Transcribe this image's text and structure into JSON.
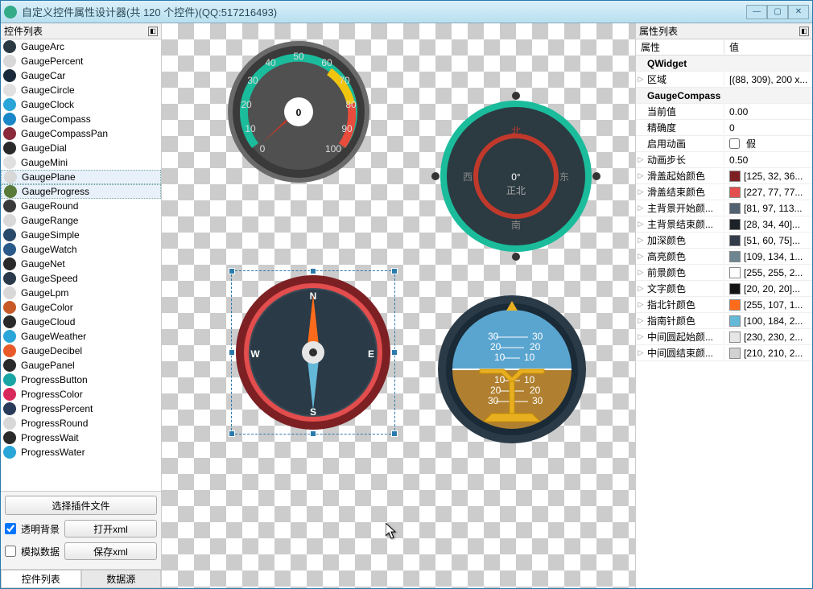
{
  "window": {
    "title": "自定义控件属性设计器(共 120 个控件)(QQ:517216493)"
  },
  "left": {
    "header": "控件列表",
    "btn_select_plugin": "选择插件文件",
    "chk_transparent": "透明背景",
    "btn_open_xml": "打开xml",
    "chk_simulate": "模拟数据",
    "btn_save_xml": "保存xml",
    "tab_controls": "控件列表",
    "tab_datasource": "数据源",
    "items": [
      {
        "label": "GaugeArc",
        "color": "#2b3a42"
      },
      {
        "label": "GaugePercent",
        "color": "#d8d8d8"
      },
      {
        "label": "GaugeCar",
        "color": "#1a2a3a"
      },
      {
        "label": "GaugeCircle",
        "color": "#e0e0e0"
      },
      {
        "label": "GaugeClock",
        "color": "#2aa5d8"
      },
      {
        "label": "GaugeCompass",
        "color": "#1a88c8"
      },
      {
        "label": "GaugeCompassPan",
        "color": "#8a2a3a"
      },
      {
        "label": "GaugeDial",
        "color": "#2a2a2a"
      },
      {
        "label": "GaugeMini",
        "color": "#e0e0e0"
      },
      {
        "label": "GaugePlane",
        "color": "#d8d8d8",
        "highlight": true
      },
      {
        "label": "GaugeProgress",
        "color": "#5a7a3a",
        "highlight": true
      },
      {
        "label": "GaugeRound",
        "color": "#3a3a3a"
      },
      {
        "label": "GaugeRange",
        "color": "#d8d8d8"
      },
      {
        "label": "GaugeSimple",
        "color": "#2a4a6a"
      },
      {
        "label": "GaugeWatch",
        "color": "#2a5a8a"
      },
      {
        "label": "GaugeNet",
        "color": "#2a2a2a"
      },
      {
        "label": "GaugeSpeed",
        "color": "#2a3a4a"
      },
      {
        "label": "GaugeLpm",
        "color": "#d8d8d8"
      },
      {
        "label": "GaugeColor",
        "color": "#c85a2a"
      },
      {
        "label": "GaugeCloud",
        "color": "#2a2a2a"
      },
      {
        "label": "GaugeWeather",
        "color": "#2aa5d8"
      },
      {
        "label": "GaugeDecibel",
        "color": "#e85a2a"
      },
      {
        "label": "GaugePanel",
        "color": "#2a2a2a"
      },
      {
        "label": "ProgressButton",
        "color": "#1aa5a5"
      },
      {
        "label": "ProgressColor",
        "color": "#d82a5a"
      },
      {
        "label": "ProgressPercent",
        "color": "#2a3a5a"
      },
      {
        "label": "ProgressRound",
        "color": "#d8d8d8"
      },
      {
        "label": "ProgressWait",
        "color": "#2a2a2a"
      },
      {
        "label": "ProgressWater",
        "color": "#2aa5d8"
      }
    ]
  },
  "right": {
    "header": "属性列表",
    "col_prop": "属性",
    "col_value": "值",
    "section_widget": "QWidget",
    "section_gauge": "GaugeCompass",
    "false_label": "假",
    "rows": [
      {
        "type": "prop",
        "name": "区域",
        "value": "[(88, 309), 200 x..."
      },
      {
        "type": "prop",
        "name": "当前值",
        "value": "0.00"
      },
      {
        "type": "prop",
        "name": "精确度",
        "value": "0"
      },
      {
        "type": "check",
        "name": "启用动画",
        "value": "假",
        "checked": false
      },
      {
        "type": "prop",
        "name": "动画步长",
        "value": "0.50"
      },
      {
        "type": "color",
        "name": "滑盖起始颜色",
        "swatch": "#7d2024",
        "value": "[125, 32, 36..."
      },
      {
        "type": "color",
        "name": "滑盖结束颜色",
        "swatch": "#e34d4d",
        "value": "[227, 77, 77..."
      },
      {
        "type": "color",
        "name": "主背景开始颜...",
        "swatch": "#516171",
        "value": "[81, 97, 113..."
      },
      {
        "type": "color",
        "name": "主背景结束颜...",
        "swatch": "#1c2228",
        "value": "[28, 34, 40]..."
      },
      {
        "type": "color",
        "name": "加深颜色",
        "swatch": "#333c4b",
        "value": "[51, 60, 75]..."
      },
      {
        "type": "color",
        "name": "高亮颜色",
        "swatch": "#6d8691",
        "value": "[109, 134, 1..."
      },
      {
        "type": "color",
        "name": "前景颜色",
        "swatch": "#ffffff",
        "value": "[255, 255, 2..."
      },
      {
        "type": "color",
        "name": "文字颜色",
        "swatch": "#141414",
        "value": "[20, 20, 20]..."
      },
      {
        "type": "color",
        "name": "指北针颜色",
        "swatch": "#ff6b1a",
        "value": "[255, 107, 1..."
      },
      {
        "type": "color",
        "name": "指南针颜色",
        "swatch": "#64b8d8",
        "value": "[100, 184, 2..."
      },
      {
        "type": "color",
        "name": "中间圆起始颜...",
        "swatch": "#e6e6e6",
        "value": "[230, 230, 2..."
      },
      {
        "type": "color",
        "name": "中间圆结束颜...",
        "swatch": "#d2d2d2",
        "value": "[210, 210, 2..."
      }
    ]
  },
  "canvas": {
    "speedometer": {
      "value": "0"
    },
    "compass_digital": {
      "deg": "0°",
      "sub": "正北",
      "n": "北",
      "s": "南",
      "e": "东",
      "w": "西"
    },
    "compass_needle": {
      "n": "N",
      "s": "S",
      "e": "E",
      "w": "W"
    },
    "attitude": {
      "ticks": [
        "30",
        "20",
        "10",
        "10",
        "20",
        "30"
      ]
    }
  }
}
